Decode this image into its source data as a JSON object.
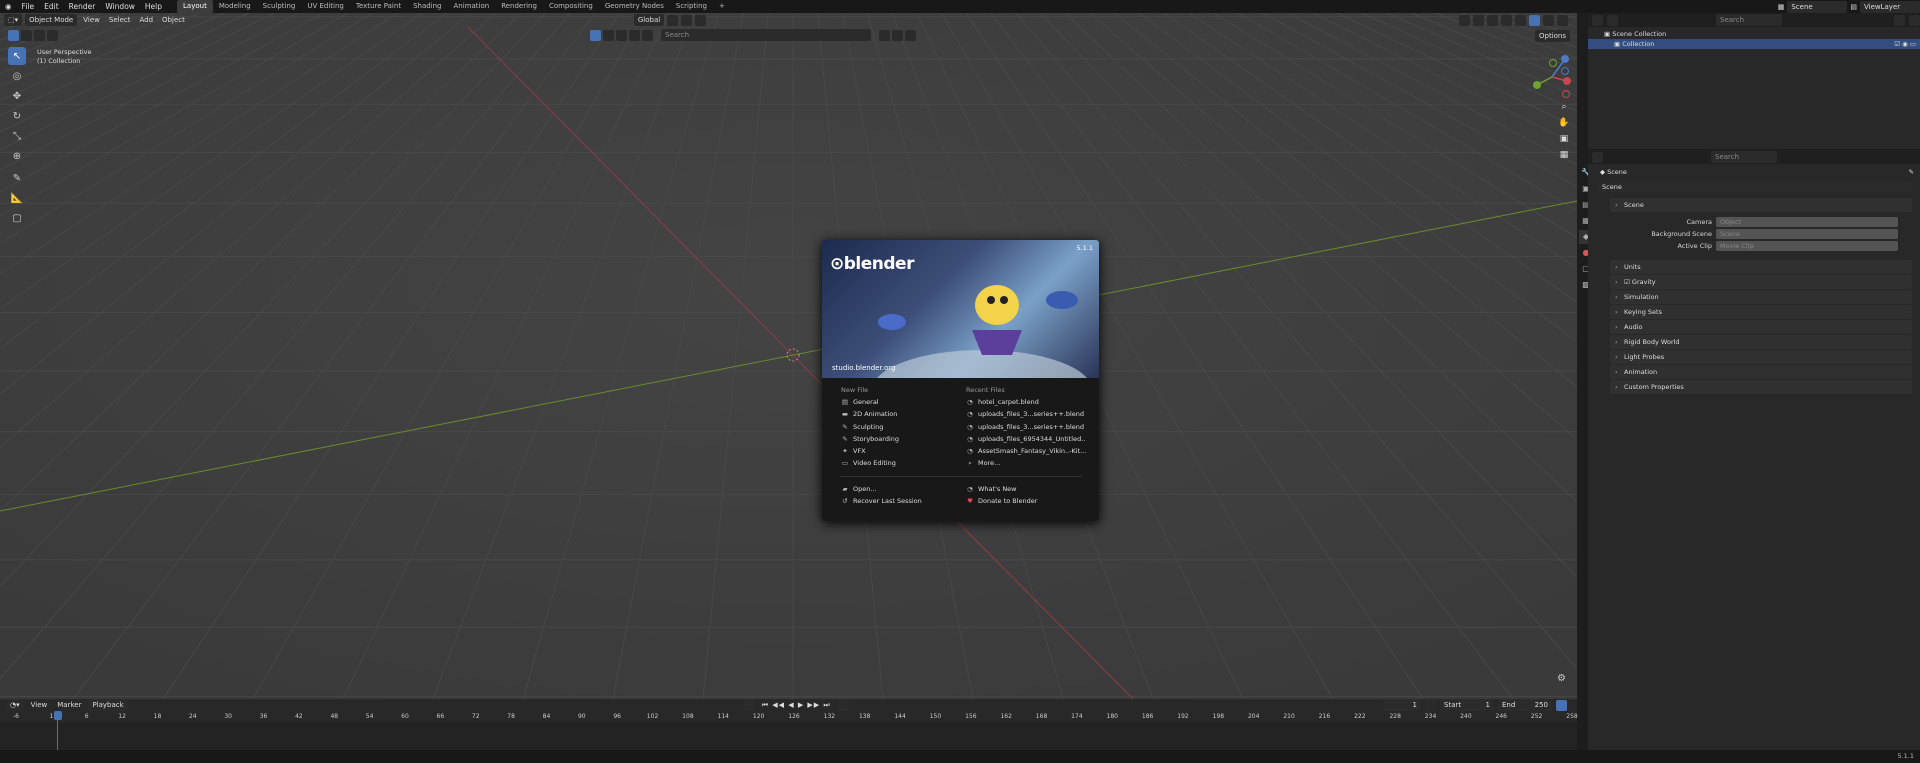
{
  "menu": {
    "file": "File",
    "edit": "Edit",
    "render": "Render",
    "window": "Window",
    "help": "Help"
  },
  "workspaces": [
    "Layout",
    "Modeling",
    "Sculpting",
    "UV Editing",
    "Texture Paint",
    "Shading",
    "Animation",
    "Rendering",
    "Compositing",
    "Geometry Nodes",
    "Scripting"
  ],
  "add_workspace": "+",
  "scene_name": "Scene",
  "view_layer": "ViewLayer",
  "viewport_header": {
    "mode": "Object Mode",
    "view": "View",
    "select": "Select",
    "add": "Add",
    "object": "Object",
    "transform": "Global",
    "search_placeholder": "Search",
    "options": "Options"
  },
  "viewport_info": {
    "perspective": "User Perspective",
    "collection": "(1) Collection"
  },
  "splash": {
    "version": "5.1.1",
    "logo": "blender",
    "url": "studio.blender.org",
    "new_file_heading": "New File",
    "recent_heading": "Recent Files",
    "new_items": [
      "General",
      "2D Animation",
      "Sculpting",
      "Storyboarding",
      "VFX",
      "Video Editing"
    ],
    "recent_items": [
      "hotel_carpet.blend",
      "uploads_files_3...series++.blend",
      "uploads_files_3...series++.blend",
      "uploads_files_6954344_Untitled...",
      "AssetSmash_Fantasy_Vikin..-Kit...",
      "More..."
    ],
    "open": "Open...",
    "recover": "Recover Last Session",
    "whats_new": "What's New",
    "donate": "Donate to Blender"
  },
  "outliner": {
    "search_placeholder": "Search",
    "scene_collection": "Scene Collection",
    "collection": "Collection"
  },
  "properties": {
    "search_placeholder": "Search",
    "breadcrumb": "Scene",
    "scene_field": "Scene",
    "scene_panel": "Scene",
    "camera_label": "Camera",
    "camera_placeholder": "Object",
    "bg_label": "Background Scene",
    "bg_placeholder": "Scene",
    "clip_label": "Active Clip",
    "clip_placeholder": "Movie Clip",
    "panels": [
      "Units",
      "Gravity",
      "Simulation",
      "Keying Sets",
      "Audio",
      "Rigid Body World",
      "Light Probes",
      "Animation",
      "Custom Properties"
    ]
  },
  "timeline": {
    "view": "View",
    "marker": "Marker",
    "playback": "Playback",
    "current_frame": "1",
    "start_label": "Start",
    "start": "1",
    "end_label": "End",
    "end": "250",
    "ticks": [
      "-6",
      "1",
      "6",
      "12",
      "18",
      "24",
      "30",
      "36",
      "42",
      "48",
      "54",
      "60",
      "66",
      "72",
      "78",
      "84",
      "90",
      "96",
      "102",
      "108",
      "114",
      "120",
      "126",
      "132",
      "138",
      "144",
      "150",
      "156",
      "162",
      "168",
      "174",
      "180",
      "186",
      "192",
      "198",
      "204",
      "210",
      "216",
      "222",
      "228",
      "234",
      "240",
      "246",
      "252",
      "258"
    ]
  },
  "status": {
    "version": "5.1.1"
  }
}
